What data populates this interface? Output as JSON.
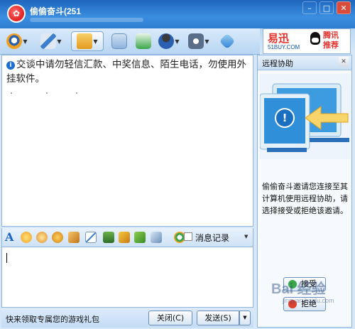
{
  "window": {
    "title": "偷偷奋斗(251",
    "controls": [
      "–",
      "□",
      "✕"
    ]
  },
  "toolbar": {
    "items": [
      {
        "name": "video-call-icon",
        "color": "#f0a020"
      },
      {
        "name": "voice-call-icon",
        "color": "#3a7fd0"
      },
      {
        "name": "send-file-icon",
        "color": "#f5b33a"
      },
      {
        "name": "email-icon",
        "color": "#7aa8d8"
      },
      {
        "name": "create-group-icon",
        "color": "#3aa64a"
      },
      {
        "name": "user-info-icon",
        "color": "#2b5fb0"
      },
      {
        "name": "settings-icon",
        "color": "#5a6e8a"
      },
      {
        "name": "app-icon",
        "color": "#4aa0e0"
      }
    ]
  },
  "ad": {
    "brand": "易迅",
    "url": "51BUY.COM",
    "partner": "腾讯推荐"
  },
  "chat": {
    "system_message": "交谈中请勿轻信汇款、中奖信息、陌生电话，勿使用外挂软件。"
  },
  "format_bar": {
    "font_label": "A",
    "message_record": "消息记录",
    "icons": [
      "emoticon-icon",
      "magic-emoticon-icon",
      "shake-icon",
      "scribble-icon",
      "screenshot-icon",
      "image-icon",
      "music-icon",
      "gift-icon",
      "app-store-icon",
      "translate-icon"
    ]
  },
  "bottom": {
    "promo": "快来领取专属您的游戏礼包",
    "close_button": "关闭(C)",
    "send_button": "发送(S)"
  },
  "remote_panel": {
    "title": "远程协助",
    "description": "偷偷奋斗邀请您连接至其计算机使用远程协助，请选择接受或拒绝该邀请。",
    "accept_button": "接受",
    "decline_button": "拒绝"
  },
  "watermark": {
    "brand": "Bai 经验",
    "url": "jingyan.baidu.com"
  },
  "colors": {
    "title_bar": "#2e7dd0",
    "accent": "#1a62c2"
  }
}
